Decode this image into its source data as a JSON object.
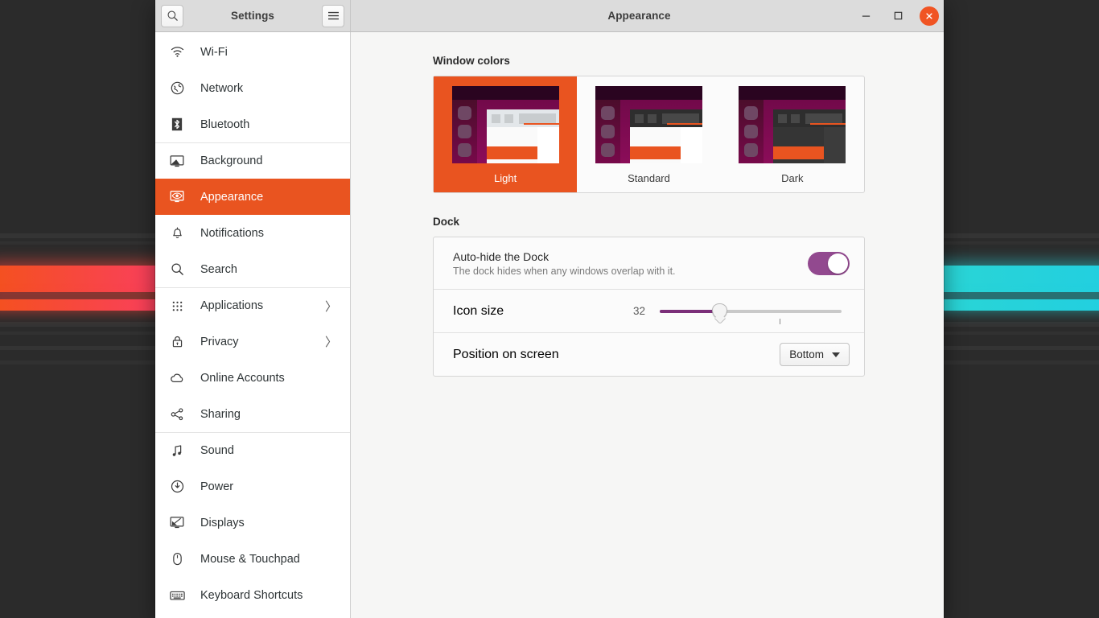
{
  "window": {
    "sidebar_title": "Settings",
    "title": "Appearance",
    "search_icon": "search-icon",
    "menu_icon": "hamburger-menu-icon",
    "minimize_label": "–",
    "maximize_label": "☐",
    "close_label": "✕",
    "accent_color": "#e95420",
    "close_color": "#f05423"
  },
  "sidebar": {
    "items": [
      {
        "label": "Wi-Fi",
        "icon": "wifi-icon",
        "active": false,
        "chevron": false,
        "separator": false
      },
      {
        "label": "Network",
        "icon": "network-globe-icon",
        "active": false,
        "chevron": false,
        "separator": false
      },
      {
        "label": "Bluetooth",
        "icon": "bluetooth-icon",
        "active": false,
        "chevron": false,
        "separator": false
      },
      {
        "label": "Background",
        "icon": "background-monitor-icon",
        "active": false,
        "chevron": false,
        "separator": true
      },
      {
        "label": "Appearance",
        "icon": "appearance-icon",
        "active": true,
        "chevron": false,
        "separator": false
      },
      {
        "label": "Notifications",
        "icon": "bell-icon",
        "active": false,
        "chevron": false,
        "separator": false
      },
      {
        "label": "Search",
        "icon": "search-icon",
        "active": false,
        "chevron": false,
        "separator": false
      },
      {
        "label": "Applications",
        "icon": "apps-grid-icon",
        "active": false,
        "chevron": true,
        "separator": true
      },
      {
        "label": "Privacy",
        "icon": "lock-icon",
        "active": false,
        "chevron": true,
        "separator": false
      },
      {
        "label": "Online Accounts",
        "icon": "cloud-icon",
        "active": false,
        "chevron": false,
        "separator": false
      },
      {
        "label": "Sharing",
        "icon": "share-nodes-icon",
        "active": false,
        "chevron": false,
        "separator": false
      },
      {
        "label": "Sound",
        "icon": "music-note-icon",
        "active": false,
        "chevron": false,
        "separator": true
      },
      {
        "label": "Power",
        "icon": "power-icon",
        "active": false,
        "chevron": false,
        "separator": false
      },
      {
        "label": "Displays",
        "icon": "displays-icon",
        "active": false,
        "chevron": false,
        "separator": false
      },
      {
        "label": "Mouse & Touchpad",
        "icon": "mouse-icon",
        "active": false,
        "chevron": false,
        "separator": false
      },
      {
        "label": "Keyboard Shortcuts",
        "icon": "keyboard-icon",
        "active": false,
        "chevron": false,
        "separator": false
      }
    ],
    "chevron_glyph": "〉"
  },
  "window_colors": {
    "section_title": "Window colors",
    "themes": [
      {
        "name": "Light",
        "variant": "light",
        "selected": true
      },
      {
        "name": "Standard",
        "variant": "standard",
        "selected": false
      },
      {
        "name": "Dark",
        "variant": "dark",
        "selected": false
      }
    ]
  },
  "dock": {
    "section_title": "Dock",
    "autohide": {
      "title": "Auto-hide the Dock",
      "subtitle": "The dock hides when any windows overlap with it.",
      "state": "on",
      "toggle_color": "#92498f"
    },
    "icon_size": {
      "label": "Icon size",
      "value": "32",
      "fill_percent": 33,
      "tick_percent": 66,
      "fill_color": "#7b2f79"
    },
    "position": {
      "label": "Position on screen",
      "value": "Bottom"
    }
  }
}
